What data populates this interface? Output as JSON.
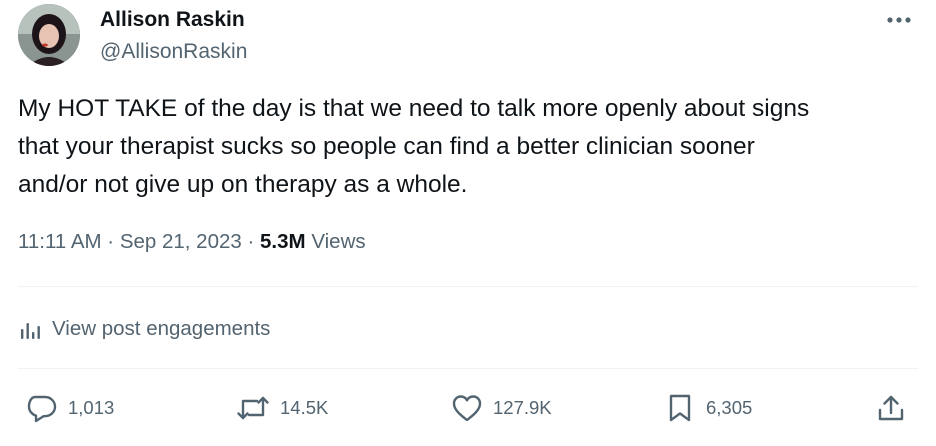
{
  "author": {
    "display_name": "Allison Raskin",
    "handle": "@AllisonRaskin"
  },
  "tweet": {
    "text_lines": [
      "My HOT TAKE of the day is that we need to talk more openly about signs",
      "that your therapist sucks so people can find a better clinician sooner",
      "and/or not give up on therapy as a whole."
    ],
    "time": "11:11 AM",
    "separator": "·",
    "date": "Sep 21, 2023",
    "views_count": "5.3M",
    "views_label": "Views"
  },
  "engagements_link": "View post engagements",
  "actions": {
    "replies": "1,013",
    "reposts": "14.5K",
    "likes": "127.9K",
    "bookmarks": "6,305"
  },
  "icons": {
    "more": "more-horizontal-icon",
    "engagements": "bar-chart-icon",
    "reply": "reply-icon",
    "repost": "repost-icon",
    "like": "heart-icon",
    "bookmark": "bookmark-icon",
    "share": "share-icon"
  },
  "colors": {
    "text_primary": "#0f1419",
    "text_secondary": "#536471",
    "divider": "#eff3f4"
  }
}
